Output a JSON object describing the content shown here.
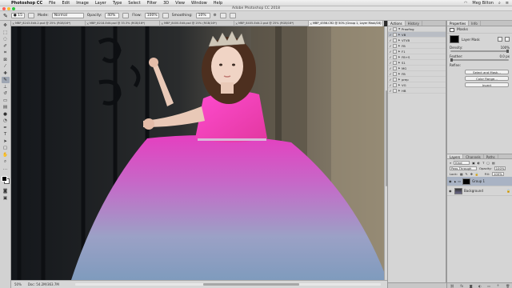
{
  "menubar": {
    "app": "Photoshop CC",
    "items": [
      "File",
      "Edit",
      "Image",
      "Layer",
      "Type",
      "Select",
      "Filter",
      "3D",
      "View",
      "Window",
      "Help"
    ],
    "user": "Meg Bilton"
  },
  "window": {
    "title": "Adobe Photoshop CC 2018"
  },
  "options": {
    "mode_label": "Mode:",
    "mode_value": "Normal",
    "opacity_label": "Opacity:",
    "opacity_value": "40%",
    "flow_label": "Flow:",
    "flow_value": "100%",
    "smoothing_label": "Smoothing:",
    "smoothing_value": "10%"
  },
  "doc_tabs": [
    "MBP_8243-Edit-2.psd @ 25% (RGB/16*)",
    "MBP_8218-Edit.psd @ 33.3% (RGB/16*)",
    "MBP_8400-Edit.psd @ 25% (RGB/16*)",
    "MBP_8405-Edit-2.psd @ 25% (RGB/16*)",
    "MBP_4556.CR2 @ 50% (Group 1, Layer Mask/16) *"
  ],
  "statusbar": {
    "zoom": "50%",
    "doc": "Doc: 54.2M/363.7M"
  },
  "actions_panel": {
    "tabs": [
      "Actions",
      "History"
    ],
    "rows": [
      "Proofing",
      "VB",
      "VTVB",
      "FB",
      "F1",
      "FB+S",
      "S1",
      "MG",
      "FB",
      "prep",
      "VG",
      "HB"
    ]
  },
  "properties_panel": {
    "tabs": [
      "Properties",
      "Info"
    ],
    "heading": "Masks",
    "mask_label": "Layer Mask",
    "density_label": "Density:",
    "density_value": "100%",
    "feather_label": "Feather:",
    "feather_value": "0.0 px",
    "refine_label": "Refine:",
    "buttons": [
      "Select and Mask...",
      "Color Range...",
      "Invert"
    ]
  },
  "layers_panel": {
    "tabs": [
      "Layers",
      "Channels",
      "Paths"
    ],
    "kind_label": "Kind",
    "blend_value": "Pass Through",
    "opacity_label": "Opacity:",
    "opacity_value": "100%",
    "lock_label": "Lock:",
    "fill_label": "Fill:",
    "fill_value": "100%",
    "layers": [
      "Group 1",
      "Background"
    ]
  },
  "colors": {
    "accent": "#a9b3c4",
    "dress_pink": "#e63fbf",
    "dress_blue": "#8fa4bf"
  }
}
